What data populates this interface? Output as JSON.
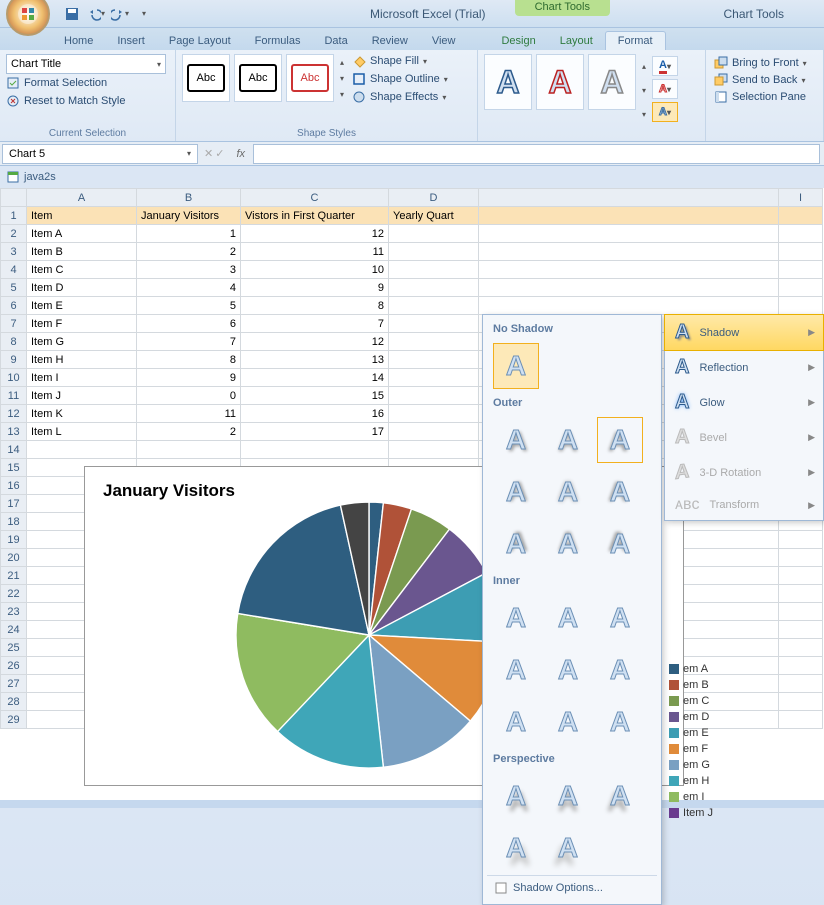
{
  "app": {
    "title": "Microsoft Excel (Trial)",
    "context_title": "Chart Tools"
  },
  "qat": {
    "save": "Save",
    "undo": "Undo",
    "redo": "Redo"
  },
  "tabs": {
    "home": "Home",
    "insert": "Insert",
    "page_layout": "Page Layout",
    "formulas": "Formulas",
    "data": "Data",
    "review": "Review",
    "view": "View",
    "design": "Design",
    "layout": "Layout",
    "format": "Format"
  },
  "ribbon": {
    "current_selection": {
      "group_label": "Current Selection",
      "dropdown_value": "Chart Title",
      "format_selection": "Format Selection",
      "reset_match": "Reset to Match Style"
    },
    "shape_styles": {
      "group_label": "Shape Styles",
      "thumb_text": "Abc",
      "shape_fill": "Shape Fill",
      "shape_outline": "Shape Outline",
      "shape_effects": "Shape Effects"
    },
    "arrange": {
      "bring_front": "Bring to Front",
      "send_back": "Send to Back",
      "selection_pane": "Selection Pane"
    }
  },
  "namebox": {
    "value": "Chart 5",
    "fx": "fx"
  },
  "doc": {
    "filename": "java2s"
  },
  "columns": [
    "A",
    "B",
    "C",
    "D",
    "I"
  ],
  "headers": {
    "item": "Item",
    "jan": "January Visitors",
    "q1": "Vistors in First Quarter",
    "yq": "Yearly Quart"
  },
  "rows": [
    {
      "n": "2",
      "item": "Item A",
      "jan": "1",
      "q1": "12"
    },
    {
      "n": "3",
      "item": "Item B",
      "jan": "2",
      "q1": "11"
    },
    {
      "n": "4",
      "item": "Item C",
      "jan": "3",
      "q1": "10"
    },
    {
      "n": "5",
      "item": "Item D",
      "jan": "4",
      "q1": "9"
    },
    {
      "n": "6",
      "item": "Item E",
      "jan": "5",
      "q1": "8"
    },
    {
      "n": "7",
      "item": "Item F",
      "jan": "6",
      "q1": "7"
    },
    {
      "n": "8",
      "item": "Item G",
      "jan": "7",
      "q1": "12"
    },
    {
      "n": "9",
      "item": "Item H",
      "jan": "8",
      "q1": "13"
    },
    {
      "n": "10",
      "item": "Item I",
      "jan": "9",
      "q1": "14"
    },
    {
      "n": "11",
      "item": "Item J",
      "jan": "0",
      "q1": "15"
    },
    {
      "n": "12",
      "item": "Item K",
      "jan": "11",
      "q1": "16"
    },
    {
      "n": "13",
      "item": "Item L",
      "jan": "2",
      "q1": "17"
    }
  ],
  "chart_data": {
    "type": "pie",
    "title": "January Visitors",
    "categories": [
      "Item A",
      "Item B",
      "Item C",
      "Item D",
      "Item E",
      "Item F",
      "Item G",
      "Item H",
      "Item I",
      "Item J",
      "Item K",
      "Item L"
    ],
    "values": [
      1,
      2,
      3,
      4,
      5,
      6,
      7,
      8,
      9,
      0,
      11,
      2
    ],
    "colors": [
      "#2e5e80",
      "#b05238",
      "#7a9a50",
      "#6a568f",
      "#3d9db3",
      "#e08b3a",
      "#7aa0c2",
      "#3fa6b8",
      "#8fbb60",
      "#b05238",
      "#2e5e80",
      "#444444"
    ]
  },
  "legend": {
    "items": [
      {
        "label": "em A",
        "color": "#2e5e80"
      },
      {
        "label": "em B",
        "color": "#b05238"
      },
      {
        "label": "em C",
        "color": "#7a9a50"
      },
      {
        "label": "em D",
        "color": "#6a568f"
      },
      {
        "label": "em E",
        "color": "#3d9db3"
      },
      {
        "label": "em F",
        "color": "#e08b3a"
      },
      {
        "label": "em G",
        "color": "#7aa0c2"
      },
      {
        "label": "em H",
        "color": "#3fa6b8"
      },
      {
        "label": "em I",
        "color": "#8fbb60"
      },
      {
        "label": "Item J",
        "color": "#6a3b8f"
      }
    ]
  },
  "shadow_flyout": {
    "no_shadow": "No Shadow",
    "outer": "Outer",
    "inner": "Inner",
    "perspective": "Perspective",
    "options": "Shadow Options..."
  },
  "effect_flyout": {
    "shadow": "Shadow",
    "reflection": "Reflection",
    "glow": "Glow",
    "bevel": "Bevel",
    "rotation": "3-D Rotation",
    "transform": "Transform"
  }
}
